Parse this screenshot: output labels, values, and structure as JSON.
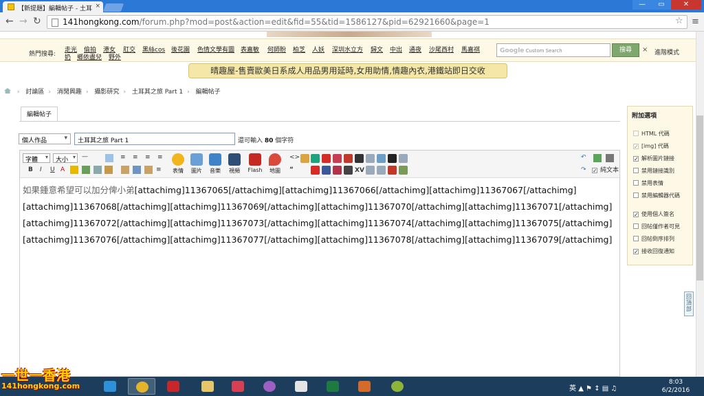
{
  "browser": {
    "tab_title": "【新提題】編輯帖子 - 土耳",
    "tab_close": "×",
    "url_host": "141hongkong.com",
    "url_path": "/forum.php?mod=post&action=edit&fid=55&tid=1586127&pid=62921660&page=1",
    "win_min": "—",
    "win_max": "▭",
    "win_close": "✕"
  },
  "header": {
    "hot_search_label": "熱門搜尋:",
    "hot_links": [
      "走光",
      "偷拍",
      "港女",
      "肛交",
      "黑絲cos",
      "後花園",
      "色情文學有圖",
      "表嘉敏",
      "何師盼",
      "柏芝",
      "人妖",
      "深圳水立方",
      "歸文",
      "中出",
      "通夜",
      "沙尾西村",
      "馬嘉祺",
      "奶",
      "鄉依盡兒",
      "野外"
    ],
    "google_placeholder": "Custom Search",
    "google_logo": "Google",
    "search_button": "搜尋",
    "clear": "×",
    "advanced": "進階模式",
    "promo": "晴趣屋-售賣歐美日系成人用品男用延時,女用助情,情趣內衣,港鐵站即日交收"
  },
  "breadcrumb": [
    "討論區",
    "消閒興趣",
    "攝影研究",
    "土耳其之旅 Part 1",
    "編輯帖子"
  ],
  "editor": {
    "tab_label": "編輯帖子",
    "category": "個人作品",
    "subject": "土耳其之旅 Part 1",
    "remain_prefix": "還可輸入",
    "remain_count": "80",
    "remain_suffix": "個字符",
    "font_select": "字體",
    "size_select": "大小",
    "tools": {
      "emoticon": "表情",
      "image": "圖片",
      "music": "音樂",
      "video": "視頻",
      "flash": "Flash",
      "map": "地圖",
      "plaintext": "純文本"
    },
    "body_lead": "如果鍾意希望可以加分俾小弟",
    "body_line1": "[attachimg]11367065[/attachimg][attachimg]11367066[/attachimg][attachimg]11367067[/attachimg]",
    "body_line2": "[attachimg]11367068[/attachimg][attachimg]11367069[/attachimg][attachimg]11367070[/attachimg][attachimg]11367071[/attachimg]",
    "body_line3": "[attachimg]11367072[/attachimg][attachimg]11367073[/attachimg][attachimg]11367074[/attachimg][attachimg]11367075[/attachimg]",
    "body_line4": "[attachimg]11367076[/attachimg][attachimg]11367077[/attachimg][attachimg]11367078[/attachimg][attachimg]11367079[/attachimg]"
  },
  "options": {
    "title": "附加選項",
    "items": [
      {
        "label": "HTML 代碼",
        "checked": false
      },
      {
        "label": "[img] 代碼",
        "checked": true
      },
      {
        "label": "解析圖片鏈接",
        "checked": true
      },
      {
        "label": "禁用鏈接識別",
        "checked": false
      },
      {
        "label": "禁用表情",
        "checked": false
      },
      {
        "label": "禁用編輯器代碼",
        "checked": false
      },
      {
        "label": "使用個人簽名",
        "checked": true
      },
      {
        "label": "回帖僅作者可見",
        "checked": false
      },
      {
        "label": "回帖倒序排列",
        "checked": false
      },
      {
        "label": "接收回復通知",
        "checked": true
      }
    ]
  },
  "back_to_top": "回頂部",
  "watermark": {
    "line1": "一世一香港",
    "line2": "141hongkong.com"
  },
  "taskbar": {
    "time": "8:03",
    "date": "6/2/2016",
    "lang": "英"
  },
  "colors": {
    "accent": "#2b78d6",
    "panel": "#fdf9e6",
    "promo": "#f5e7a8"
  }
}
